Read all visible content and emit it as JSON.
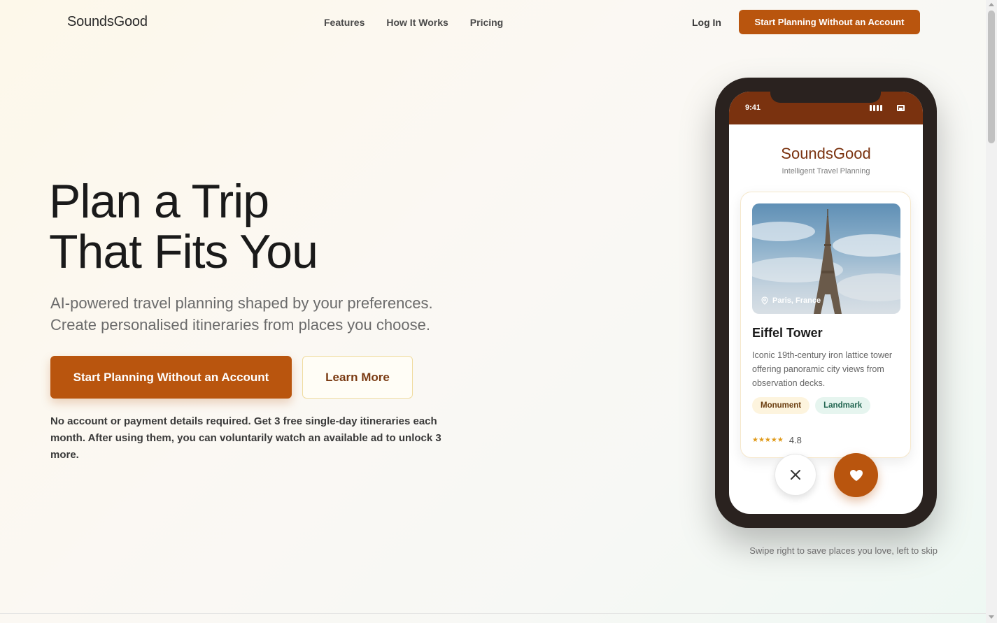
{
  "nav": {
    "logo": "SoundsGood",
    "links": [
      "Features",
      "How It Works",
      "Pricing"
    ],
    "login": "Log In",
    "cta": "Start Planning Without an Account"
  },
  "hero": {
    "title_line1": "Plan a Trip",
    "title_line2": "That Fits You",
    "subtitle_line1": "AI-powered travel planning shaped by your preferences.",
    "subtitle_line2": "Create personalised itineraries from places you choose.",
    "primary_button": "Start Planning Without an Account",
    "secondary_button": "Learn More",
    "note": "No account or payment details required. Get 3 free single-day itineraries each month. After using them, you can voluntarily watch an available ad to unlock 3 more."
  },
  "phone": {
    "time": "9:41",
    "app_name": "SoundsGood",
    "app_tagline": "Intelligent Travel Planning",
    "card": {
      "location": "Paris, France",
      "title": "Eiffel Tower",
      "description": "Iconic 19th-century iron lattice tower offering panoramic city views from observation decks.",
      "tags": [
        "Monument",
        "Landmark"
      ],
      "stars": "★★★★★",
      "rating": "4.8"
    }
  },
  "swipe_hint": "Swipe right to save places you love, left to skip",
  "colors": {
    "accent": "#b9550e",
    "phone_header": "#7a320f",
    "star": "#e09a1a"
  },
  "icons": [
    "location-pin-icon",
    "close-icon",
    "heart-icon",
    "signal-icon",
    "battery-icon"
  ]
}
